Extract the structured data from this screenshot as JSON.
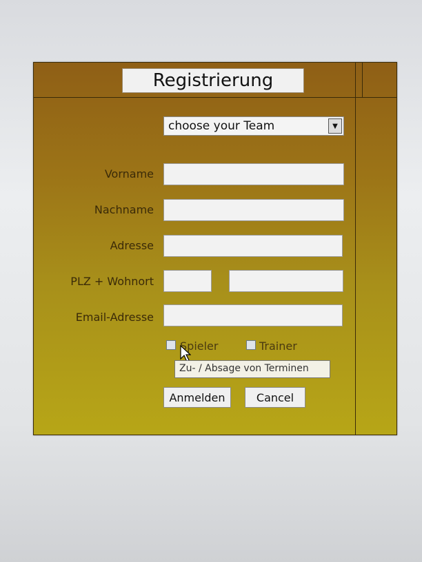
{
  "form": {
    "title": "Registrierung",
    "team_select": {
      "value": "choose your Team"
    },
    "fields": {
      "vorname_label": "Vorname",
      "nachname_label": "Nachname",
      "adresse_label": "Adresse",
      "plz_label": "PLZ + Wohnort",
      "email_label": "Email-Adresse"
    },
    "role_options": {
      "spieler": "Spieler",
      "trainer": "Trainer"
    },
    "tooltip": "Zu- / Absage von Terminen",
    "buttons": {
      "submit": "Anmelden",
      "cancel": "Cancel"
    }
  },
  "colors": {
    "panel_top": "#8f5f16",
    "panel_bottom": "#b7a617",
    "border": "#3a2a08"
  },
  "icons": {
    "dropdown": "chevron-down-icon",
    "cursor": "mouse-pointer-icon"
  }
}
